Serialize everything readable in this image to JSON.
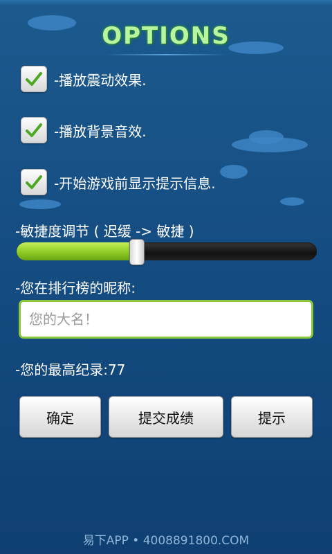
{
  "title": "OPTIONS",
  "options": [
    {
      "label": "-播放震动效果.",
      "checked": true
    },
    {
      "label": "-播放背景音效.",
      "checked": true
    },
    {
      "label": "-开始游戏前显示提示信息.",
      "checked": true
    }
  ],
  "sensitivity": {
    "label": "-敏捷度调节 ( 迟缓 -> 敏捷 )",
    "value": 0.4
  },
  "nickname": {
    "label": "-您在排行榜的昵称:",
    "placeholder": "您的大名！",
    "value": ""
  },
  "high_score": "-您的最高纪录:77",
  "buttons": {
    "confirm": "确定",
    "submit_score": "提交成绩",
    "hint": "提示"
  },
  "footer": "易下APP • 4008891800.COM",
  "colors": {
    "accent_green": "#89c93a",
    "background": "#154d82"
  }
}
